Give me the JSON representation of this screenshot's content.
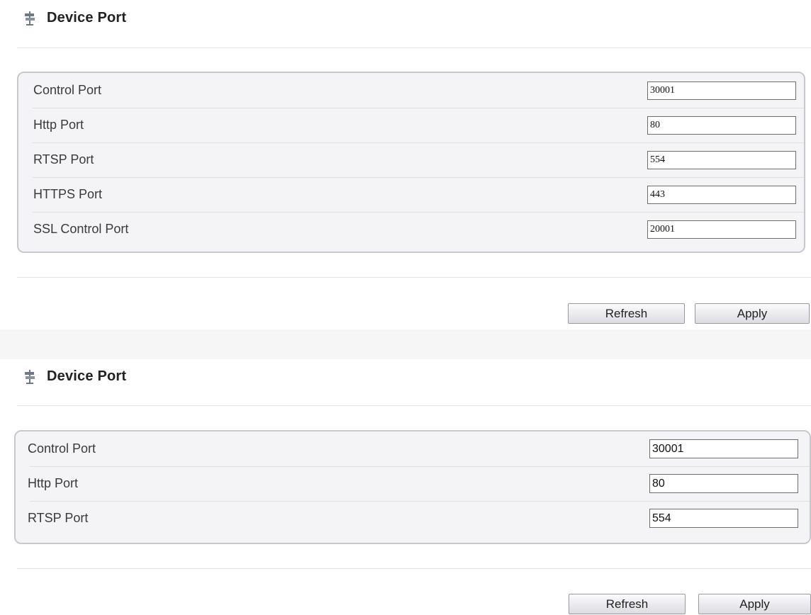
{
  "sections": [
    {
      "title": "Device Port",
      "icon": "signpost-icon",
      "fields": [
        {
          "label": "Control Port",
          "value": "30001"
        },
        {
          "label": "Http Port",
          "value": "80"
        },
        {
          "label": "RTSP Port",
          "value": "554"
        },
        {
          "label": "HTTPS Port",
          "value": "443"
        },
        {
          "label": "SSL Control Port",
          "value": "20001"
        }
      ],
      "buttons": {
        "refresh": "Refresh",
        "apply": "Apply"
      }
    },
    {
      "title": "Device Port",
      "icon": "signpost-icon",
      "fields": [
        {
          "label": "Control Port",
          "value": "30001"
        },
        {
          "label": "Http Port",
          "value": "80"
        },
        {
          "label": "RTSP Port",
          "value": "554"
        }
      ],
      "buttons": {
        "refresh": "Refresh",
        "apply": "Apply"
      }
    }
  ],
  "colors": {
    "panel_bg": "#f4f4f7",
    "panel_border": "#c7c8cf",
    "separator": "#e3e3e3"
  }
}
